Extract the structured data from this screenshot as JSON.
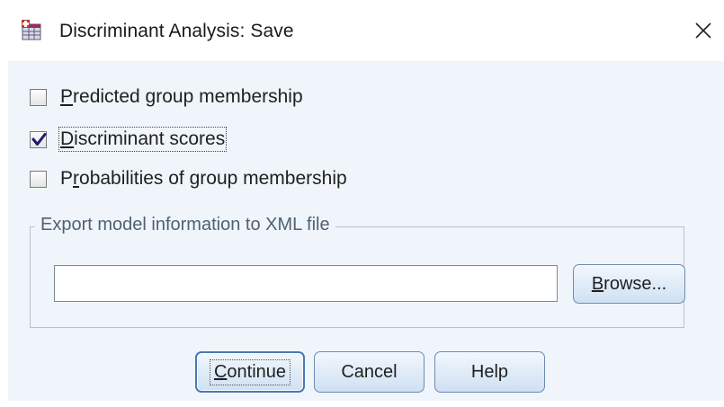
{
  "window": {
    "title": "Discriminant Analysis: Save",
    "app_icon": "spss-dialog-icon",
    "close_icon": "close-icon"
  },
  "options": [
    {
      "prefix": "",
      "mnemonic": "P",
      "suffix": "redicted group membership",
      "checked": false
    },
    {
      "prefix": "",
      "mnemonic": "D",
      "suffix": "iscriminant scores",
      "checked": true
    },
    {
      "prefix": "P",
      "mnemonic": "r",
      "suffix": "obabilities of group membership",
      "checked": false
    }
  ],
  "export": {
    "legend": "Export model information to XML file",
    "value": "",
    "browse": {
      "mnemonic": "B",
      "suffix": "rowse..."
    }
  },
  "buttons": {
    "continue": {
      "mnemonic": "C",
      "suffix": "ontinue"
    },
    "cancel": "Cancel",
    "help": "Help"
  },
  "colors": {
    "client_bg": "#f0f5fb",
    "button_border": "#6e8cb0",
    "legend_text": "#4f6173"
  }
}
